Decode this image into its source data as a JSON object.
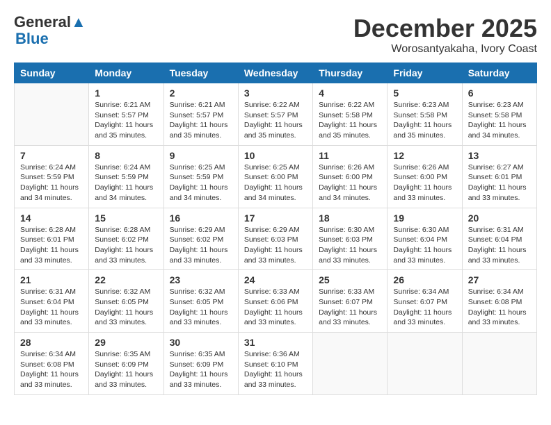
{
  "logo": {
    "line1": "General",
    "line2": "Blue"
  },
  "title": "December 2025",
  "location": "Worosantyakaha, Ivory Coast",
  "weekdays": [
    "Sunday",
    "Monday",
    "Tuesday",
    "Wednesday",
    "Thursday",
    "Friday",
    "Saturday"
  ],
  "weeks": [
    [
      {
        "day": "",
        "sunrise": "",
        "sunset": "",
        "daylight": ""
      },
      {
        "day": "1",
        "sunrise": "Sunrise: 6:21 AM",
        "sunset": "Sunset: 5:57 PM",
        "daylight": "Daylight: 11 hours and 35 minutes."
      },
      {
        "day": "2",
        "sunrise": "Sunrise: 6:21 AM",
        "sunset": "Sunset: 5:57 PM",
        "daylight": "Daylight: 11 hours and 35 minutes."
      },
      {
        "day": "3",
        "sunrise": "Sunrise: 6:22 AM",
        "sunset": "Sunset: 5:57 PM",
        "daylight": "Daylight: 11 hours and 35 minutes."
      },
      {
        "day": "4",
        "sunrise": "Sunrise: 6:22 AM",
        "sunset": "Sunset: 5:58 PM",
        "daylight": "Daylight: 11 hours and 35 minutes."
      },
      {
        "day": "5",
        "sunrise": "Sunrise: 6:23 AM",
        "sunset": "Sunset: 5:58 PM",
        "daylight": "Daylight: 11 hours and 35 minutes."
      },
      {
        "day": "6",
        "sunrise": "Sunrise: 6:23 AM",
        "sunset": "Sunset: 5:58 PM",
        "daylight": "Daylight: 11 hours and 34 minutes."
      }
    ],
    [
      {
        "day": "7",
        "sunrise": "Sunrise: 6:24 AM",
        "sunset": "Sunset: 5:59 PM",
        "daylight": "Daylight: 11 hours and 34 minutes."
      },
      {
        "day": "8",
        "sunrise": "Sunrise: 6:24 AM",
        "sunset": "Sunset: 5:59 PM",
        "daylight": "Daylight: 11 hours and 34 minutes."
      },
      {
        "day": "9",
        "sunrise": "Sunrise: 6:25 AM",
        "sunset": "Sunset: 5:59 PM",
        "daylight": "Daylight: 11 hours and 34 minutes."
      },
      {
        "day": "10",
        "sunrise": "Sunrise: 6:25 AM",
        "sunset": "Sunset: 6:00 PM",
        "daylight": "Daylight: 11 hours and 34 minutes."
      },
      {
        "day": "11",
        "sunrise": "Sunrise: 6:26 AM",
        "sunset": "Sunset: 6:00 PM",
        "daylight": "Daylight: 11 hours and 34 minutes."
      },
      {
        "day": "12",
        "sunrise": "Sunrise: 6:26 AM",
        "sunset": "Sunset: 6:00 PM",
        "daylight": "Daylight: 11 hours and 33 minutes."
      },
      {
        "day": "13",
        "sunrise": "Sunrise: 6:27 AM",
        "sunset": "Sunset: 6:01 PM",
        "daylight": "Daylight: 11 hours and 33 minutes."
      }
    ],
    [
      {
        "day": "14",
        "sunrise": "Sunrise: 6:28 AM",
        "sunset": "Sunset: 6:01 PM",
        "daylight": "Daylight: 11 hours and 33 minutes."
      },
      {
        "day": "15",
        "sunrise": "Sunrise: 6:28 AM",
        "sunset": "Sunset: 6:02 PM",
        "daylight": "Daylight: 11 hours and 33 minutes."
      },
      {
        "day": "16",
        "sunrise": "Sunrise: 6:29 AM",
        "sunset": "Sunset: 6:02 PM",
        "daylight": "Daylight: 11 hours and 33 minutes."
      },
      {
        "day": "17",
        "sunrise": "Sunrise: 6:29 AM",
        "sunset": "Sunset: 6:03 PM",
        "daylight": "Daylight: 11 hours and 33 minutes."
      },
      {
        "day": "18",
        "sunrise": "Sunrise: 6:30 AM",
        "sunset": "Sunset: 6:03 PM",
        "daylight": "Daylight: 11 hours and 33 minutes."
      },
      {
        "day": "19",
        "sunrise": "Sunrise: 6:30 AM",
        "sunset": "Sunset: 6:04 PM",
        "daylight": "Daylight: 11 hours and 33 minutes."
      },
      {
        "day": "20",
        "sunrise": "Sunrise: 6:31 AM",
        "sunset": "Sunset: 6:04 PM",
        "daylight": "Daylight: 11 hours and 33 minutes."
      }
    ],
    [
      {
        "day": "21",
        "sunrise": "Sunrise: 6:31 AM",
        "sunset": "Sunset: 6:04 PM",
        "daylight": "Daylight: 11 hours and 33 minutes."
      },
      {
        "day": "22",
        "sunrise": "Sunrise: 6:32 AM",
        "sunset": "Sunset: 6:05 PM",
        "daylight": "Daylight: 11 hours and 33 minutes."
      },
      {
        "day": "23",
        "sunrise": "Sunrise: 6:32 AM",
        "sunset": "Sunset: 6:05 PM",
        "daylight": "Daylight: 11 hours and 33 minutes."
      },
      {
        "day": "24",
        "sunrise": "Sunrise: 6:33 AM",
        "sunset": "Sunset: 6:06 PM",
        "daylight": "Daylight: 11 hours and 33 minutes."
      },
      {
        "day": "25",
        "sunrise": "Sunrise: 6:33 AM",
        "sunset": "Sunset: 6:07 PM",
        "daylight": "Daylight: 11 hours and 33 minutes."
      },
      {
        "day": "26",
        "sunrise": "Sunrise: 6:34 AM",
        "sunset": "Sunset: 6:07 PM",
        "daylight": "Daylight: 11 hours and 33 minutes."
      },
      {
        "day": "27",
        "sunrise": "Sunrise: 6:34 AM",
        "sunset": "Sunset: 6:08 PM",
        "daylight": "Daylight: 11 hours and 33 minutes."
      }
    ],
    [
      {
        "day": "28",
        "sunrise": "Sunrise: 6:34 AM",
        "sunset": "Sunset: 6:08 PM",
        "daylight": "Daylight: 11 hours and 33 minutes."
      },
      {
        "day": "29",
        "sunrise": "Sunrise: 6:35 AM",
        "sunset": "Sunset: 6:09 PM",
        "daylight": "Daylight: 11 hours and 33 minutes."
      },
      {
        "day": "30",
        "sunrise": "Sunrise: 6:35 AM",
        "sunset": "Sunset: 6:09 PM",
        "daylight": "Daylight: 11 hours and 33 minutes."
      },
      {
        "day": "31",
        "sunrise": "Sunrise: 6:36 AM",
        "sunset": "Sunset: 6:10 PM",
        "daylight": "Daylight: 11 hours and 33 minutes."
      },
      {
        "day": "",
        "sunrise": "",
        "sunset": "",
        "daylight": ""
      },
      {
        "day": "",
        "sunrise": "",
        "sunset": "",
        "daylight": ""
      },
      {
        "day": "",
        "sunrise": "",
        "sunset": "",
        "daylight": ""
      }
    ]
  ]
}
